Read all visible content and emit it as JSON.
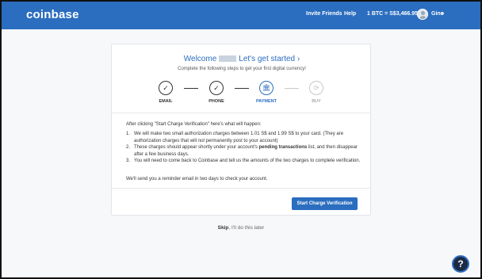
{
  "header": {
    "logo": "coinbase",
    "invite_friends": "Invite Friends",
    "help": "Help",
    "price": "1 BTC = S$3,466.95",
    "user_name": "Gino",
    "user_chevron": "▾"
  },
  "card": {
    "welcome_prefix": "Welcome",
    "welcome_suffix": "Let's get started ›",
    "subtitle": "Complete the following steps to get your first digital currency!",
    "steps": [
      {
        "label": "EMAIL",
        "icon": "check-icon",
        "glyph": "✓",
        "state": "done"
      },
      {
        "label": "PHONE",
        "icon": "check-icon",
        "glyph": "✓",
        "state": "done"
      },
      {
        "label": "PAYMENT",
        "icon": "bank-icon",
        "glyph": "🏛",
        "state": "active"
      },
      {
        "label": "BUY",
        "icon": "coin-icon",
        "glyph": "⟳",
        "state": "disabled"
      }
    ],
    "intro": "After clicking \"Start Charge Verification\" here's what will happen:",
    "items": [
      {
        "num": "1.",
        "text_a": "We will make two small authorization charges between 1.01 S$ and 1.99 S$ to your card. (They are authorization charges that will ",
        "em": "not",
        "text_b": " permanently post to your account)"
      },
      {
        "num": "2.",
        "text_a": "These charges should appear shortly under your account's ",
        "strong": "pending transactions",
        "text_b": " list, and then disappear after a few business days."
      },
      {
        "num": "3.",
        "text_a": "You will need to come back to Coinbase and tell us the amounts of the two charges to complete verification."
      }
    ],
    "reminder": "We'll send you a reminder email in two days to check your account.",
    "button": "Start Charge Verification"
  },
  "skip": {
    "bold": "Skip",
    "rest": ", I'll do this later"
  },
  "help_fab": "?",
  "colors": {
    "brand": "#2b6dbf",
    "background": "#f7f8fa"
  }
}
